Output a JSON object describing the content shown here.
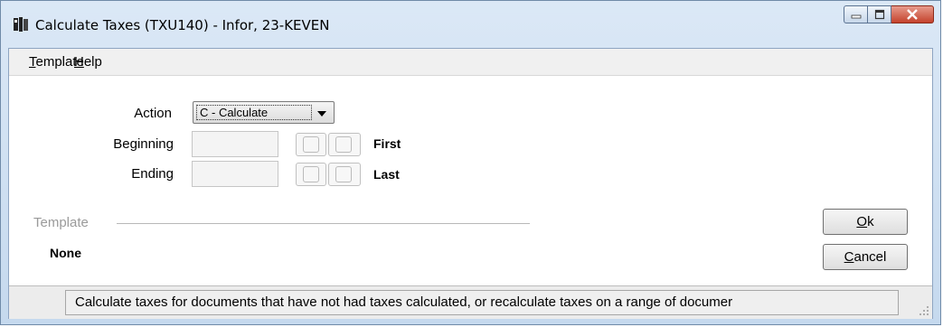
{
  "window": {
    "title": "Calculate Taxes (TXU140) - Infor, 23-KEVEN"
  },
  "menu": {
    "items": [
      {
        "label_u": "T",
        "label_rest": "emplate"
      },
      {
        "label_u": "H",
        "label_rest": "elp"
      }
    ]
  },
  "form": {
    "action_label": "Action",
    "action_value": "C - Calculate",
    "beginning_label": "Beginning",
    "beginning_value": "",
    "beginning_hint": "First",
    "ending_label": "Ending",
    "ending_value": "",
    "ending_hint": "Last"
  },
  "template_group": {
    "title": "Template",
    "value": "None"
  },
  "buttons": {
    "ok_u": "O",
    "ok_rest": "k",
    "cancel_u": "C",
    "cancel_rest": "ancel"
  },
  "status": {
    "text": "Calculate taxes for documents that have not had taxes calculated, or recalculate taxes on a range of documer"
  },
  "colors": {
    "title_bar": "#c5d9ee",
    "close_button": "#c4422c",
    "menubar": "#f0f0f0"
  },
  "icons": [
    "app-icon",
    "minimize-icon",
    "maximize-icon",
    "close-icon",
    "dropdown-arrow-icon",
    "size-grip-icon"
  ]
}
